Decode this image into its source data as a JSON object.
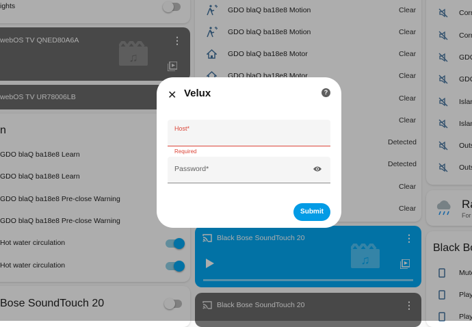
{
  "left": {
    "top_row": {
      "label": "ights",
      "toggle_on": false
    },
    "tv1": {
      "title": "webOS TV QNED80A6A",
      "icon": "film-music-icon",
      "source_icon": "play-box-icon"
    },
    "tv2": {
      "title": "webOS TV UR78006LB"
    },
    "section": {
      "heading": "n",
      "rows": [
        {
          "label": "GDO blaQ ba18e8 Learn"
        },
        {
          "label": "GDO blaQ ba18e8 Learn"
        },
        {
          "label": "GDO blaQ ba18e8 Pre-close Warning"
        },
        {
          "label": "GDO blaQ ba18e8 Pre-close Warning"
        },
        {
          "label": "Hot water circulation",
          "toggle_on": true
        },
        {
          "label": "Hot water circulation",
          "toggle_on": true
        }
      ]
    },
    "bose_row": {
      "label": "Bose SoundTouch 20",
      "toggle_on": false
    }
  },
  "middle": {
    "rows": [
      {
        "label": "GDO blaQ ba18e8 Motion",
        "state": "Clear",
        "icon": "motion-icon"
      },
      {
        "label": "GDO blaQ ba18e8 Motion",
        "state": "Clear",
        "icon": "motion-icon"
      },
      {
        "label": "GDO blaQ ba18e8 Motor",
        "state": "Clear",
        "icon": "home-icon"
      },
      {
        "label": "GDO blaQ ba18e8 Motor",
        "state": "Clear",
        "icon": "home-icon"
      },
      {
        "label": "",
        "state": "Clear"
      },
      {
        "label": "",
        "state": "Clear"
      },
      {
        "label": "",
        "state": "Detected"
      },
      {
        "label": "",
        "state": "Detected"
      },
      {
        "label": "",
        "state": "Clear"
      },
      {
        "label": "",
        "state": "Clear"
      }
    ],
    "media1": {
      "title": "Black Bose SoundTouch 20",
      "color": "#03a9f4"
    },
    "media2": {
      "title": "Black Bose SoundTouch 20",
      "color": "#6b6b6b"
    }
  },
  "right": {
    "rows": [
      "Corn",
      "Corn",
      "GDO",
      "GDO",
      "Islan",
      "Islan",
      "Outs",
      "Outs"
    ],
    "weather": {
      "title": "Ra",
      "subtitle": "For"
    },
    "bose": {
      "title": "Black Bo",
      "items": [
        "Mute",
        "Play-",
        "Play-"
      ]
    }
  },
  "dialog": {
    "title": "Velux",
    "host_label": "Host*",
    "host_value": "",
    "host_error": "Required",
    "password_label": "Password*",
    "password_value": "",
    "submit_label": "Submit",
    "accent": "#039be5",
    "error_color": "#db4437"
  }
}
